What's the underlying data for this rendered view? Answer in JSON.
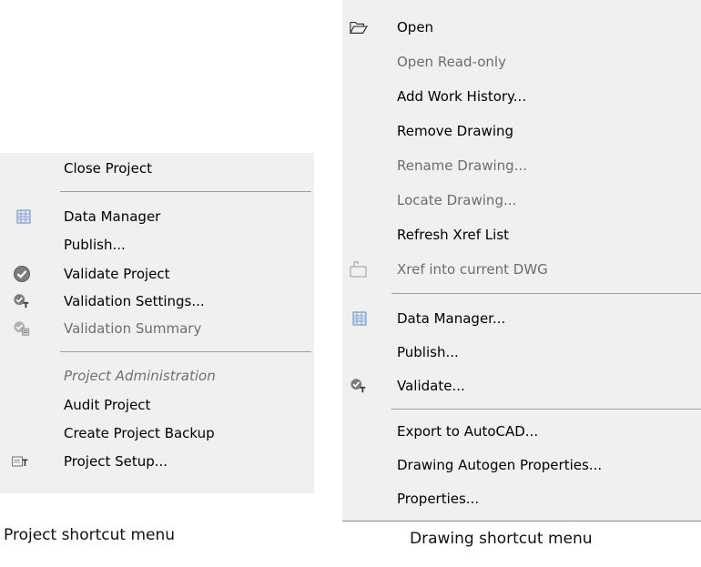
{
  "project_menu": {
    "items": [
      {
        "label": "Close Project"
      },
      {
        "label": "Data Manager",
        "icon": "data-manager-icon"
      },
      {
        "label": "Publish..."
      },
      {
        "label": "Validate Project",
        "icon": "validate-check-icon"
      },
      {
        "label": "Validation Settings...",
        "icon": "validation-settings-icon"
      },
      {
        "label": "Validation Summary",
        "icon": "validation-summary-icon",
        "disabled": true
      },
      {
        "label": "Project Administration",
        "header": true
      },
      {
        "label": "Audit Project"
      },
      {
        "label": "Create Project Backup"
      },
      {
        "label": "Project Setup...",
        "icon": "project-setup-icon"
      }
    ],
    "caption": "Project shortcut menu"
  },
  "drawing_menu": {
    "items": [
      {
        "label": "Open",
        "icon": "open-folder-icon"
      },
      {
        "label": "Open Read-only",
        "disabled": true
      },
      {
        "label": "Add Work History..."
      },
      {
        "label": "Remove Drawing"
      },
      {
        "label": "Rename Drawing...",
        "disabled": true
      },
      {
        "label": "Locate Drawing...",
        "disabled": true
      },
      {
        "label": "Refresh Xref List"
      },
      {
        "label": "Xref into current DWG",
        "icon": "xref-icon",
        "disabled": true
      },
      {
        "label": "Data Manager...",
        "icon": "data-manager-icon"
      },
      {
        "label": "Publish..."
      },
      {
        "label": "Validate...",
        "icon": "validation-settings-icon"
      },
      {
        "label": "Export to AutoCAD..."
      },
      {
        "label": "Drawing Autogen Properties..."
      },
      {
        "label": "Properties..."
      }
    ],
    "caption": "Drawing shortcut menu"
  },
  "colors": {
    "menu_bg": "#f0f0f0",
    "separator": "#a0a0a0",
    "disabled_text": "#6d6d6d"
  }
}
